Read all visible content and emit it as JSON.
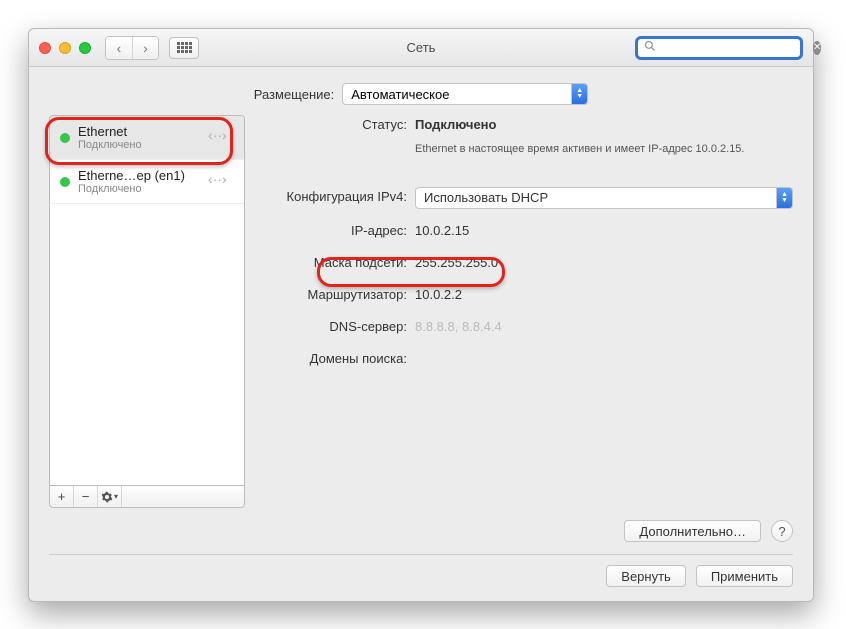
{
  "window": {
    "title": "Сеть"
  },
  "search": {
    "placeholder": ""
  },
  "location": {
    "label": "Размещение:",
    "value": "Автоматическое"
  },
  "sidebar": {
    "items": [
      {
        "name": "Ethernet",
        "status": "Подключено"
      },
      {
        "name": "Etherne…ep (en1)",
        "status": "Подключено"
      }
    ]
  },
  "detail": {
    "status_label": "Статус:",
    "status_value": "Подключено",
    "status_desc": "Ethernet в настоящее время активен и имеет IP-адрес 10.0.2.15.",
    "config_label": "Конфигурация IPv4:",
    "config_value": "Использовать DHCP",
    "ip_label": "IP-адрес:",
    "ip_value": "10.0.2.15",
    "mask_label": "Маска подсети:",
    "mask_value": "255.255.255.0",
    "router_label": "Маршрутизатор:",
    "router_value": "10.0.2.2",
    "dns_label": "DNS-сервер:",
    "dns_value": "8.8.8.8, 8.8.4.4",
    "search_label": "Домены поиска:",
    "search_value": ""
  },
  "buttons": {
    "advanced": "Дополнительно…",
    "revert": "Вернуть",
    "apply": "Применить"
  }
}
